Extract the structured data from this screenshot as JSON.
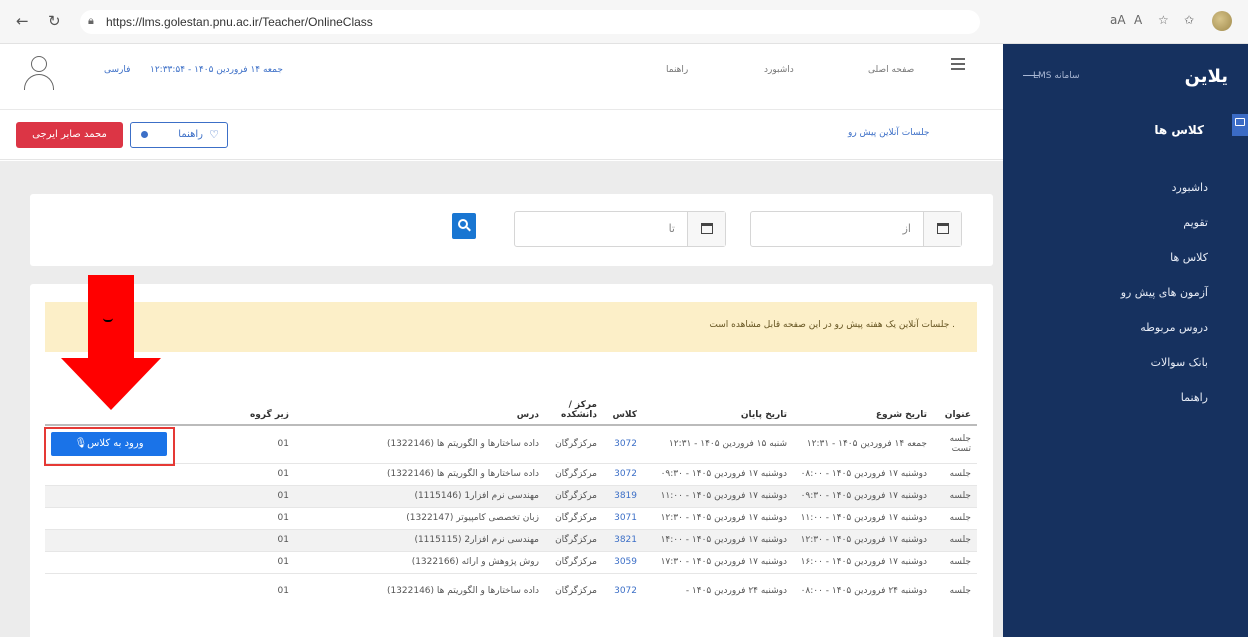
{
  "browser": {
    "url": "https://lms.golestan.pnu.ac.ir/Teacher/OnlineClass",
    "icons": [
      "back-icon",
      "refresh-icon",
      "lock-icon",
      "read-aloud-icon",
      "font-icon",
      "favorite-icon",
      "collections-icon",
      "profile-icon"
    ]
  },
  "sidebar": {
    "brand": "یلاین",
    "lms_label": "LMS سامانه",
    "section": "کلاس ها",
    "items": [
      "داشبورد",
      "تقویم",
      "کلاس ها",
      "آزمون های پیش رو",
      "دروس مربوطه",
      "بانک سوالات",
      "راهنما"
    ]
  },
  "header": {
    "lang": "فارسی",
    "datetime": "جمعه ۱۴ فروردین ۱۴۰۵ - ۱۲:۳۳:۵۴",
    "menu": [
      "راهنما",
      "داشبورد",
      "صفحه اصلی"
    ]
  },
  "crumbbar": {
    "user": "محمد صابر ایرجی",
    "help": "راهنما",
    "breadcrumb": "جلسات آنلاین پیش رو"
  },
  "search": {
    "from_placeholder": "از",
    "to_placeholder": "تا"
  },
  "notice": "جلسات آنلاین یک هفته پیش رو در این صفحه قابل مشاهده است .",
  "table": {
    "headers": {
      "title": "عنوان",
      "start": "تاریخ شروع",
      "end": "تاریخ پایان",
      "class": "کلاس",
      "center": "مرکز / دانشکده",
      "course": "درس",
      "group": "زیر گروه",
      "action": ""
    },
    "enter_label": "ورود به کلاس",
    "rows": [
      {
        "title": "جلسه تست",
        "start": "جمعه ۱۴ فروردین ۱۴۰۵ - ۱۲:۳۱",
        "end": "شنبه ۱۵ فروردین ۱۴۰۵ - ۱۲:۳۱",
        "class": "3072",
        "center": "مرکزگرگان",
        "course": "داده ساختارها و الگوریتم ها (1322146)",
        "group": "01"
      },
      {
        "title": "جلسه",
        "start": "دوشنبه ۱۷ فروردین ۱۴۰۵ - ۰۸:۰۰",
        "end": "دوشنبه ۱۷ فروردین ۱۴۰۵ - ۰۹:۳۰",
        "class": "3072",
        "center": "مرکزگرگان",
        "course": "داده ساختارها و الگوریتم ها (1322146)",
        "group": "01"
      },
      {
        "title": "جلسه",
        "start": "دوشنبه ۱۷ فروردین ۱۴۰۵ - ۰۹:۳۰",
        "end": "دوشنبه ۱۷ فروردین ۱۴۰۵ - ۱۱:۰۰",
        "class": "3819",
        "center": "مرکزگرگان",
        "course": "مهندسی نرم افزار1 (1115146)",
        "group": "01"
      },
      {
        "title": "جلسه",
        "start": "دوشنبه ۱۷ فروردین ۱۴۰۵ - ۱۱:۰۰",
        "end": "دوشنبه ۱۷ فروردین ۱۴۰۵ - ۱۲:۳۰",
        "class": "3071",
        "center": "مرکزگرگان",
        "course": "زبان تخصصی کامپیوتر (1322147)",
        "group": "01"
      },
      {
        "title": "جلسه",
        "start": "دوشنبه ۱۷ فروردین ۱۴۰۵ - ۱۲:۳۰",
        "end": "دوشنبه ۱۷ فروردین ۱۴۰۵ - ۱۴:۰۰",
        "class": "3821",
        "center": "مرکزگرگان",
        "course": "مهندسی نرم افزار2 (1115115)",
        "group": "01"
      },
      {
        "title": "جلسه",
        "start": "دوشنبه ۱۷ فروردین ۱۴۰۵ - ۱۶:۰۰",
        "end": "دوشنبه ۱۷ فروردین ۱۴۰۵ - ۱۷:۳۰",
        "class": "3059",
        "center": "مرکزگرگان",
        "course": "روش پژوهش و ارائه (1322166)",
        "group": "01"
      },
      {
        "title": "جلسه",
        "start": "دوشنبه ۲۴ فروردین ۱۴۰۵ - ۰۸:۰۰",
        "end": "دوشنبه ۲۴ فروردین ۱۴۰۵ -",
        "class": "3072",
        "center": "مرکزگرگان",
        "course": "داده ساختارها و الگوریتم ها (1322146)",
        "group": "01"
      }
    ]
  },
  "annotation": {
    "color": "#ff0000"
  }
}
